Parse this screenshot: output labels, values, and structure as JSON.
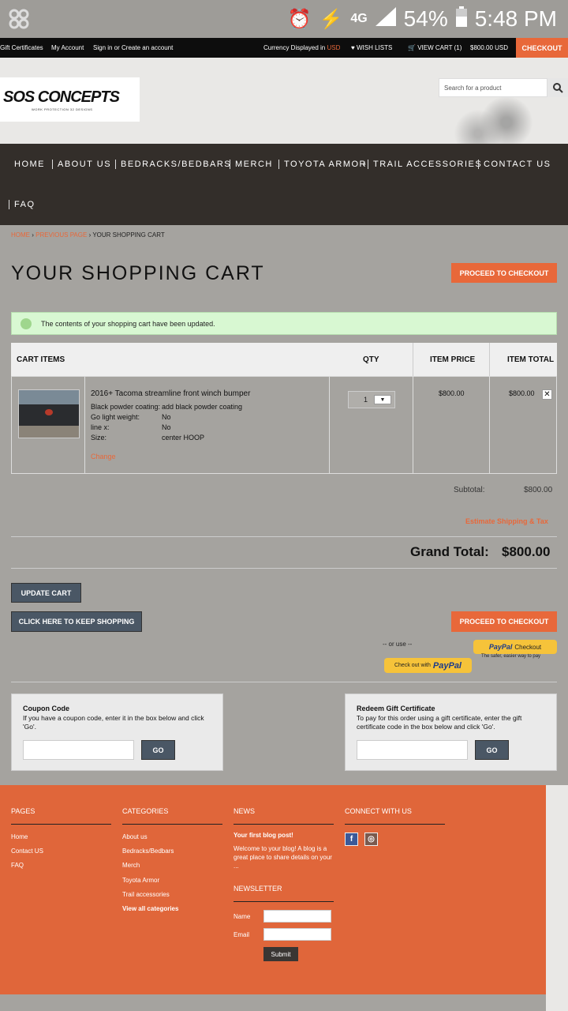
{
  "status_bar": {
    "network": "4G",
    "battery": "54%",
    "time": "5:48 PM"
  },
  "top_bar": {
    "gift_certificates": "Gift Certificates",
    "my_account": "My Account",
    "sign_in": "Sign in or Create an account",
    "currency_label": "Currency Displayed in",
    "currency": "USD",
    "wish_lists": "WISH LISTS",
    "view_cart": "VIEW CART (1)",
    "cart_total": "$800.00 USD",
    "checkout": "CHECKOUT"
  },
  "header": {
    "logo_text": "SOS CONCEPTS",
    "logo_tagline": "WORK PROTECTION 32 DESIGNS",
    "search_placeholder": "Search for a product"
  },
  "nav": {
    "items": [
      "HOME",
      "ABOUT US",
      "BEDRACKS/BEDBARS",
      "MERCH",
      "TOYOTA ARMOR",
      "TRAIL ACCESSORIES",
      "CONTACT US",
      "FAQ"
    ]
  },
  "breadcrumb": {
    "home": "HOME",
    "previous": "PREVIOUS PAGE",
    "current": "YOUR SHOPPING CART"
  },
  "page": {
    "title": "YOUR SHOPPING CART",
    "proceed_checkout": "PROCEED TO CHECKOUT",
    "notice": "The contents of your shopping cart have been updated."
  },
  "cart": {
    "headers": {
      "items": "CART ITEMS",
      "qty": "QTY",
      "price": "ITEM PRICE",
      "total": "ITEM TOTAL"
    },
    "item": {
      "name": "2016+ Tacoma streamline front winch bumper",
      "options": [
        {
          "label": "Black powder coating:",
          "value": "add black powder coating"
        },
        {
          "label": "Go light weight:",
          "value": "No"
        },
        {
          "label": "line x:",
          "value": "No"
        },
        {
          "label": "Size:",
          "value": "center HOOP"
        }
      ],
      "change": "Change",
      "qty": "1",
      "price": "$800.00",
      "total": "$800.00"
    },
    "subtotal_label": "Subtotal:",
    "subtotal": "$800.00",
    "estimate": "Estimate Shipping & Tax",
    "grand_total_label": "Grand Total:",
    "grand_total": "$800.00",
    "update_cart": "UPDATE CART",
    "keep_shopping": "CLICK HERE TO KEEP SHOPPING",
    "or_use": "-- or use --",
    "paypal_checkout_prefix": "PayPal",
    "paypal_checkout_suffix": "Checkout",
    "paypal_tagline": "The safer, easier way to pay",
    "paypal_checkout_out": "Check out with",
    "paypal_brand": "PayPal"
  },
  "coupon": {
    "title": "Coupon Code",
    "desc": "If you have a coupon code, enter it in the box below and click 'Go'.",
    "go": "GO"
  },
  "gift": {
    "title": "Redeem Gift Certificate",
    "desc": "To pay for this order using a gift certificate, enter the gift certificate code in the box below and click 'Go'.",
    "go": "GO"
  },
  "footer": {
    "pages_title": "PAGES",
    "pages": [
      "Home",
      "Contact US",
      "FAQ"
    ],
    "categories_title": "CATEGORIES",
    "categories": [
      "About us",
      "Bedracks/Bedbars",
      "Merch",
      "Toyota Armor",
      "Trail accessories"
    ],
    "view_all": "View all categories",
    "news_title": "NEWS",
    "blog_title": "Your first blog post!",
    "blog_text": "Welcome to your blog! A blog is a great place to share details on your ...",
    "newsletter_title": "NEWSLETTER",
    "name_label": "Name",
    "email_label": "Email",
    "submit": "Submit",
    "connect_title": "CONNECT WITH US",
    "facebook": "f",
    "instagram": "◎"
  },
  "colors": {
    "accent": "#e8683a",
    "nav": "#332e2a",
    "slate": "#4a5765"
  }
}
